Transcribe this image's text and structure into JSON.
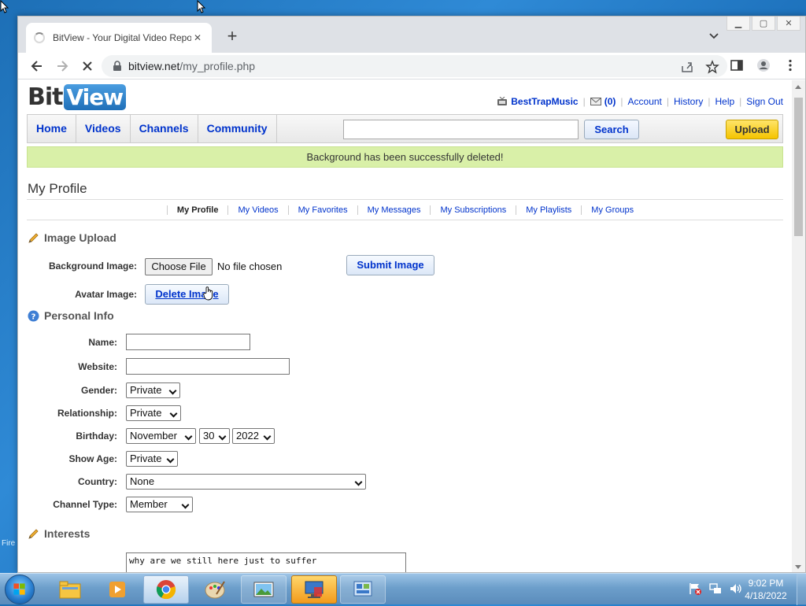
{
  "desktop": {
    "partial_icon_label": "Fire"
  },
  "browser": {
    "tab_title": "BitView - Your Digital Video Repository",
    "url_host": "bitview.net",
    "url_path": "/my_profile.php",
    "new_tab_label": "+"
  },
  "site": {
    "logo_bit": "Bit",
    "logo_view": "View",
    "userbar": {
      "username": "BestTrapMusic",
      "messages_count": "(0)",
      "account": "Account",
      "history": "History",
      "help": "Help",
      "signout": "Sign Out"
    },
    "nav": {
      "home": "Home",
      "videos": "Videos",
      "channels": "Channels",
      "community": "Community",
      "search_button": "Search",
      "upload_button": "Upload",
      "search_value": ""
    },
    "alert": "Background has been successfully deleted!",
    "page_title": "My Profile",
    "subnav": [
      "My Profile",
      "My Videos",
      "My Favorites",
      "My Messages",
      "My Subscriptions",
      "My Playlists",
      "My Groups"
    ],
    "image_upload": {
      "heading": "Image Upload",
      "background_label": "Background Image:",
      "choose_file": "Choose File",
      "no_file": "No file chosen",
      "submit": "Submit Image",
      "avatar_label": "Avatar Image:",
      "delete": "Delete Image"
    },
    "personal_info": {
      "heading": "Personal Info",
      "name_label": "Name:",
      "name_value": "",
      "website_label": "Website:",
      "website_value": "",
      "gender_label": "Gender:",
      "gender_value": "Private",
      "relationship_label": "Relationship:",
      "relationship_value": "Private",
      "birthday_label": "Birthday:",
      "birthday_month": "November",
      "birthday_day": "30",
      "birthday_year": "2022",
      "show_age_label": "Show Age:",
      "show_age_value": "Private",
      "country_label": "Country:",
      "country_value": "None",
      "channel_type_label": "Channel Type:",
      "channel_type_value": "Member"
    },
    "interests": {
      "heading": "Interests",
      "text": "why are we still here just to suffer"
    }
  },
  "taskbar": {
    "time": "9:02 PM",
    "date": "4/18/2022"
  }
}
